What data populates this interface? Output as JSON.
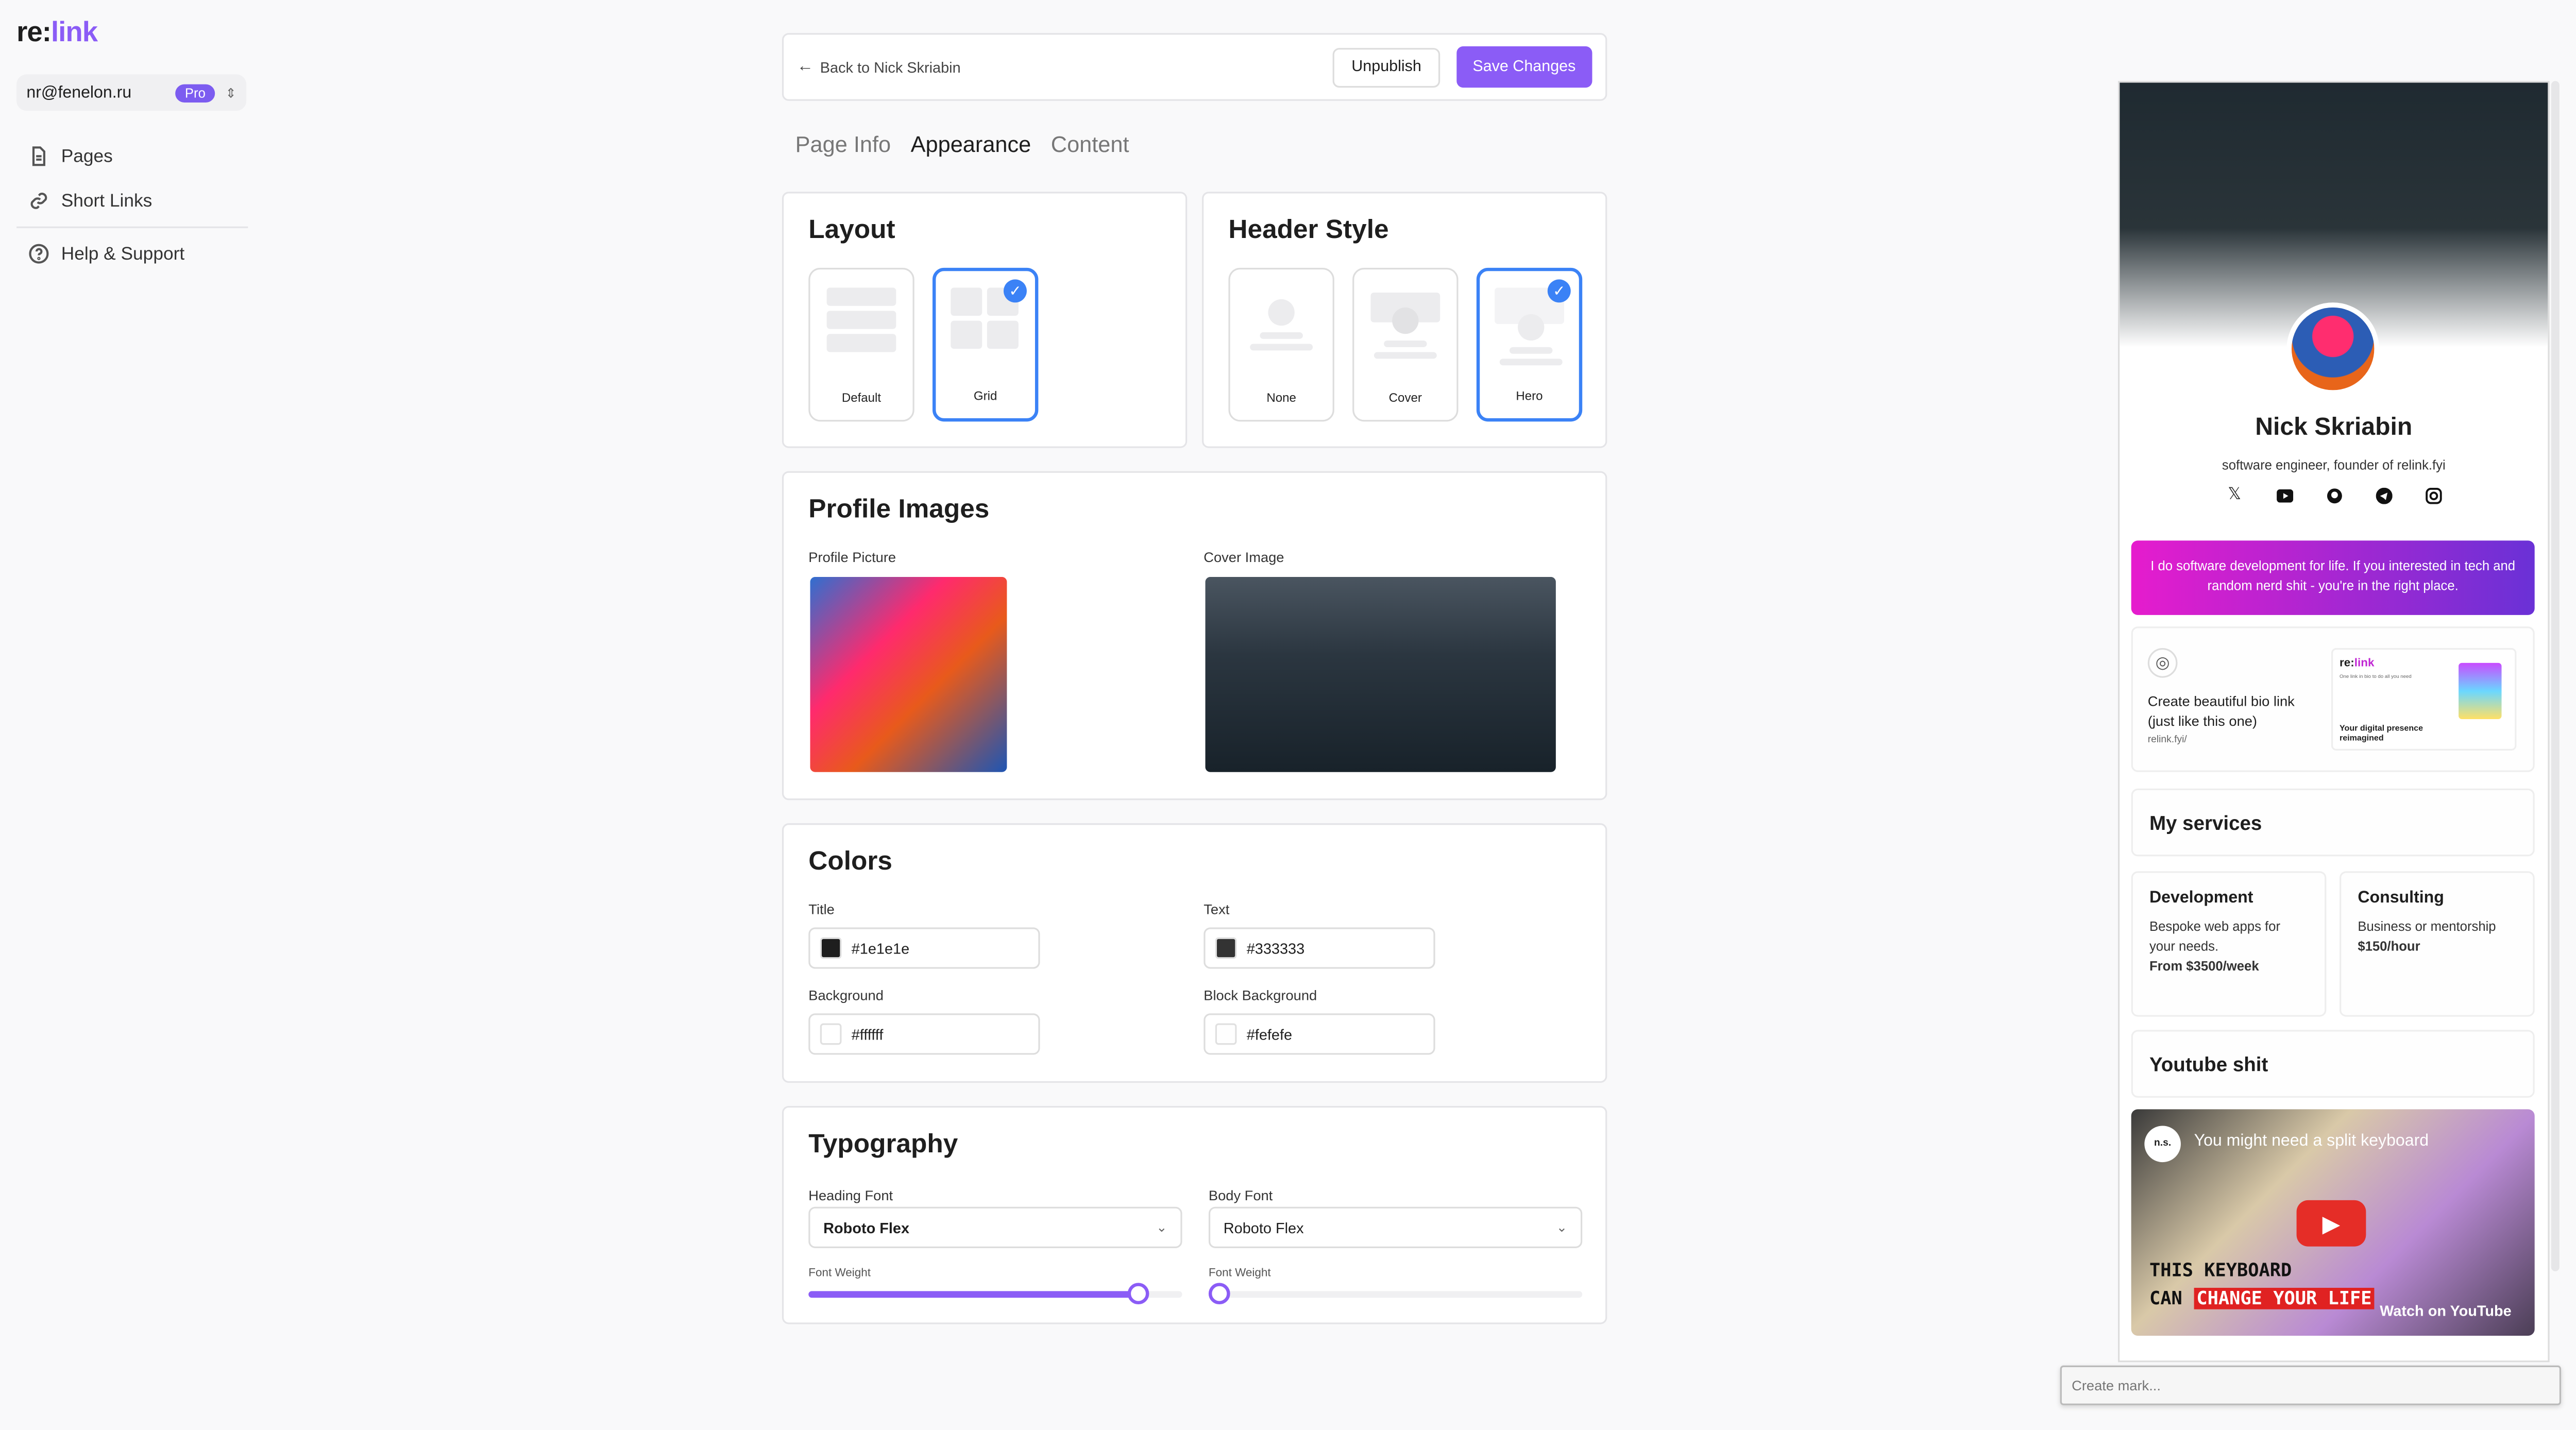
{
  "brand": {
    "logo_prefix": "re:",
    "logo_suffix": "link"
  },
  "account": {
    "email": "nr@fenelon.ru",
    "badge": "Pro"
  },
  "sidebar": {
    "items": [
      {
        "label": "Pages",
        "icon": "file-icon"
      },
      {
        "label": "Short Links",
        "icon": "link-icon"
      },
      {
        "label": "Help & Support",
        "icon": "help-icon"
      }
    ]
  },
  "topbar": {
    "back_label": "Back to Nick Skriabin",
    "unpublish_label": "Unpublish",
    "save_label": "Save Changes"
  },
  "tabs": [
    {
      "label": "Page Info",
      "active": false
    },
    {
      "label": "Appearance",
      "active": true
    },
    {
      "label": "Content",
      "active": false
    }
  ],
  "layout": {
    "title": "Layout",
    "options": [
      {
        "label": "Default",
        "selected": false
      },
      {
        "label": "Grid",
        "selected": true
      }
    ]
  },
  "header_style": {
    "title": "Header Style",
    "options": [
      {
        "label": "None",
        "selected": false
      },
      {
        "label": "Cover",
        "selected": false
      },
      {
        "label": "Hero",
        "selected": true
      }
    ]
  },
  "profile_images": {
    "title": "Profile Images",
    "profile_label": "Profile Picture",
    "cover_label": "Cover Image"
  },
  "colors": {
    "title": "Colors",
    "title_label": "Title",
    "title_value": "#1e1e1e",
    "text_label": "Text",
    "text_value": "#333333",
    "background_label": "Background",
    "background_value": "#ffffff",
    "block_bg_label": "Block Background",
    "block_bg_value": "#fefefe"
  },
  "typography": {
    "title": "Typography",
    "heading_font_label": "Heading Font",
    "heading_font_value": "Roboto Flex",
    "body_font_label": "Body Font",
    "body_font_value": "Roboto Flex",
    "heading_weight_label": "Font Weight",
    "heading_weight_fraction": 0.88,
    "body_weight_label": "Font Weight",
    "body_weight_fraction": 0.0
  },
  "preview": {
    "name": "Nick Skriabin",
    "bio": "software engineer, founder of relink.fyi",
    "socials": [
      "x-icon",
      "youtube-icon",
      "github-icon",
      "telegram-icon",
      "instagram-icon"
    ],
    "banner_text": "I do software development for life. If you interested in tech and random nerd shit - you're in the right place.",
    "link_card": {
      "title": "Create beautiful bio link (just like this one)",
      "url": "relink.fyi/",
      "thumb_logo_prefix": "re:",
      "thumb_logo_suffix": "link",
      "thumb_small": "One link in bio to do all you need",
      "thumb_tagline": "Your digital presence reimagined"
    },
    "services_title": "My services",
    "services": [
      {
        "title": "Development",
        "desc": "Bespoke web apps for your needs.",
        "price": "From $3500/week"
      },
      {
        "title": "Consulting",
        "desc": "Business or mentorship",
        "price": "$150/hour"
      }
    ],
    "youtube_title": "Youtube shit",
    "video": {
      "title": "You might need a split keyboard",
      "line1": "THIS KEYBOARD",
      "line2_prefix": "CAN",
      "line2_highlight": "CHANGE YOUR LIFE",
      "watch": "Watch on YouTube",
      "channel": "n.s."
    }
  },
  "mark_input": {
    "placeholder": "Create mark..."
  },
  "accent_color": "#8b5cf6",
  "selection_color": "#3b82f6"
}
